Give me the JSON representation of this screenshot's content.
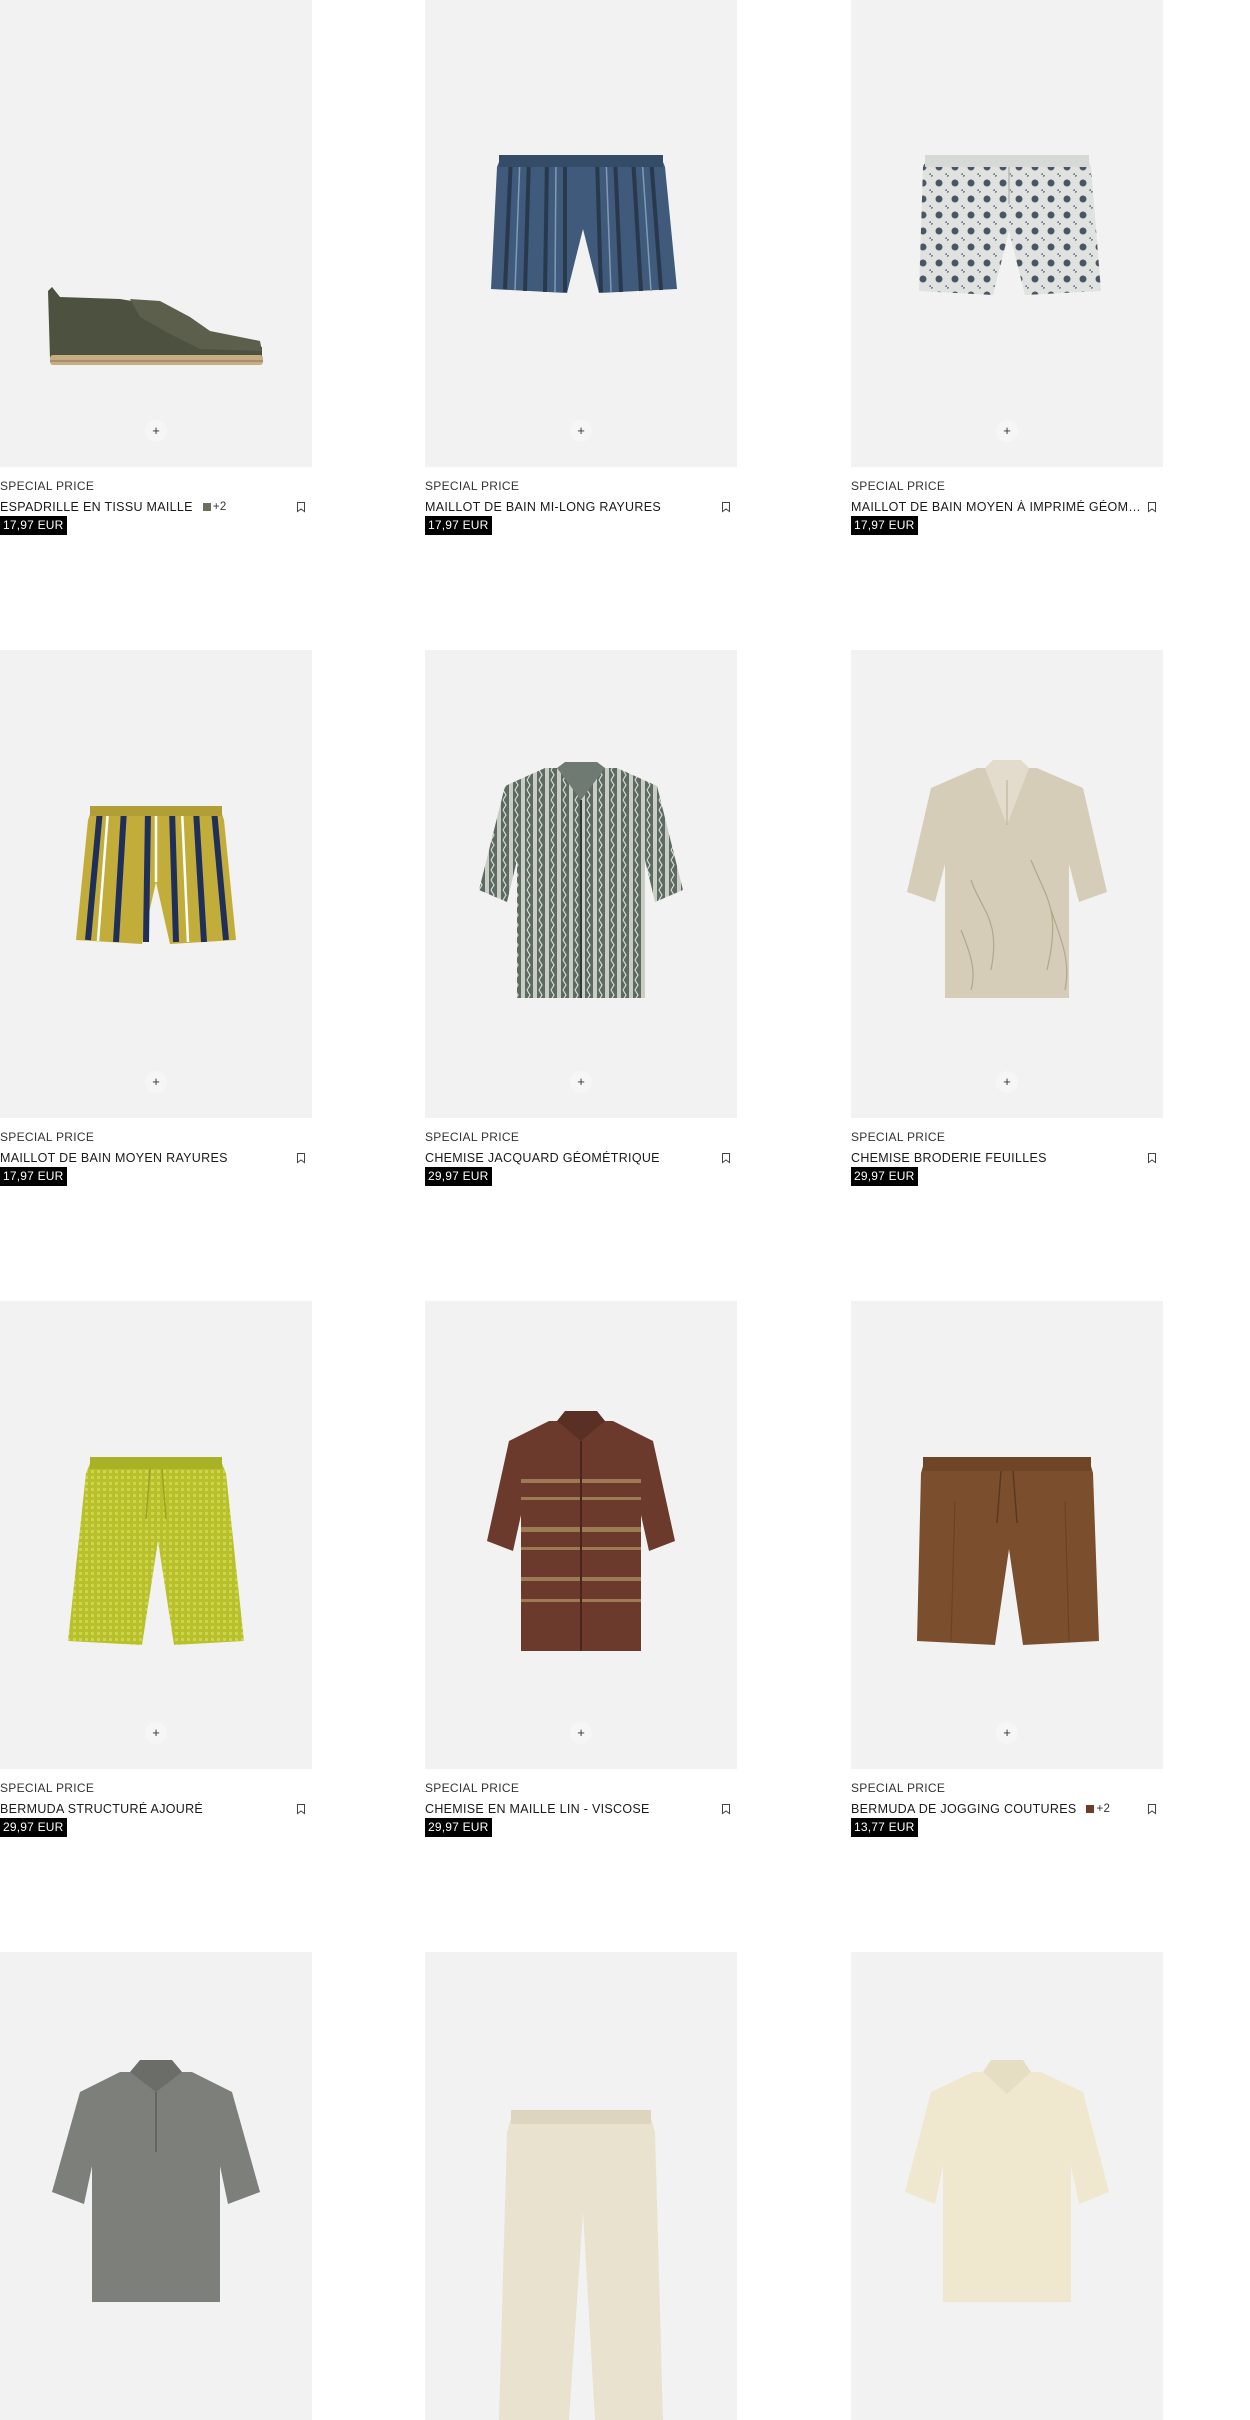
{
  "products": [
    {
      "tag": "SPECIAL PRICE",
      "name": "ESPADRILLE EN TISSU MAILLE",
      "price": "17,97 EUR",
      "colors_more": "+2",
      "swatch": "#6e6e5c",
      "image": "espadrille-image"
    },
    {
      "tag": "SPECIAL PRICE",
      "name": "MAILLOT DE BAIN MI-LONG RAYURES",
      "price": "17,97 EUR",
      "colors_more": "",
      "swatch": "",
      "image": "striped-blue-swim-shorts-image"
    },
    {
      "tag": "SPECIAL PRICE",
      "name": "MAILLOT DE BAIN MOYEN À IMPRIMÉ GÉOMÉTRIQUE",
      "price": "17,97 EUR",
      "colors_more": "",
      "swatch": "",
      "image": "geometric-print-swim-shorts-image"
    },
    {
      "tag": "SPECIAL PRICE",
      "name": "MAILLOT DE BAIN MOYEN RAYURES",
      "price": "17,97 EUR",
      "colors_more": "",
      "swatch": "",
      "image": "yellow-blue-striped-swim-shorts-image"
    },
    {
      "tag": "SPECIAL PRICE",
      "name": "CHEMISE JACQUARD GÉOMÉTRIQUE",
      "price": "29,97 EUR",
      "colors_more": "",
      "swatch": "",
      "image": "jacquard-shirt-image"
    },
    {
      "tag": "SPECIAL PRICE",
      "name": "CHEMISE BRODERIE FEUILLES",
      "price": "29,97 EUR",
      "colors_more": "",
      "swatch": "",
      "image": "leaf-embroidery-shirt-image"
    },
    {
      "tag": "SPECIAL PRICE",
      "name": "BERMUDA STRUCTURÉ AJOURÉ",
      "price": "29,97 EUR",
      "colors_more": "",
      "swatch": "",
      "image": "lime-openwork-bermuda-image"
    },
    {
      "tag": "SPECIAL PRICE",
      "name": "CHEMISE EN MAILLE LIN - VISCOSE",
      "price": "29,97 EUR",
      "colors_more": "",
      "swatch": "",
      "image": "brown-knit-shirt-image"
    },
    {
      "tag": "SPECIAL PRICE",
      "name": "BERMUDA DE JOGGING COUTURES",
      "price": "13,77 EUR",
      "colors_more": "+2",
      "swatch": "#6b3f2a",
      "image": "brown-jogging-bermuda-image"
    },
    {
      "tag": "",
      "name": "",
      "price": "",
      "colors_more": "",
      "swatch": "",
      "image": "grey-polo-image"
    },
    {
      "tag": "",
      "name": "",
      "price": "",
      "colors_more": "",
      "swatch": "",
      "image": "cream-trousers-image"
    },
    {
      "tag": "",
      "name": "",
      "price": "",
      "colors_more": "",
      "swatch": "",
      "image": "cream-polo-image"
    }
  ],
  "ui": {
    "quick_add_label": "+",
    "bookmark_icon": "bookmark-icon",
    "colors": {
      "image_bg": "#f2f2f2",
      "price_bg": "#000000",
      "price_text": "#ffffff"
    }
  }
}
